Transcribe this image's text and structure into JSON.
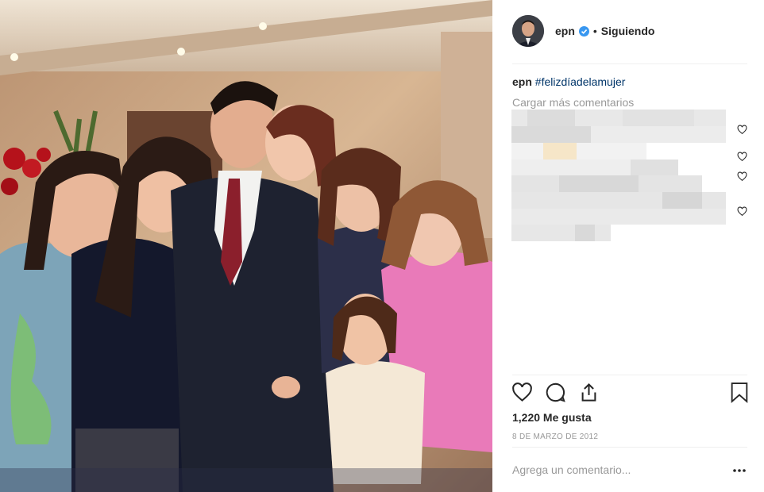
{
  "post": {
    "username": "epn",
    "separator": "•",
    "follow_status": "Siguiendo",
    "caption_user": "epn",
    "caption_hashtag": "#felizdíadelamujer",
    "load_more": "Cargar más comentarios",
    "likes": "1,220 Me gusta",
    "date": "8 DE MARZO DE 2012",
    "comment_placeholder": "Agrega un comentario..."
  },
  "icons": {
    "verified": "verified-badge-icon",
    "like": "heart-icon",
    "comment": "comment-bubble-icon",
    "share": "share-upload-icon",
    "save": "bookmark-icon",
    "options": "more-options-icon"
  },
  "colors": {
    "link": "#003569",
    "verified": "#3897f0",
    "muted": "#999999",
    "text": "#262626"
  }
}
